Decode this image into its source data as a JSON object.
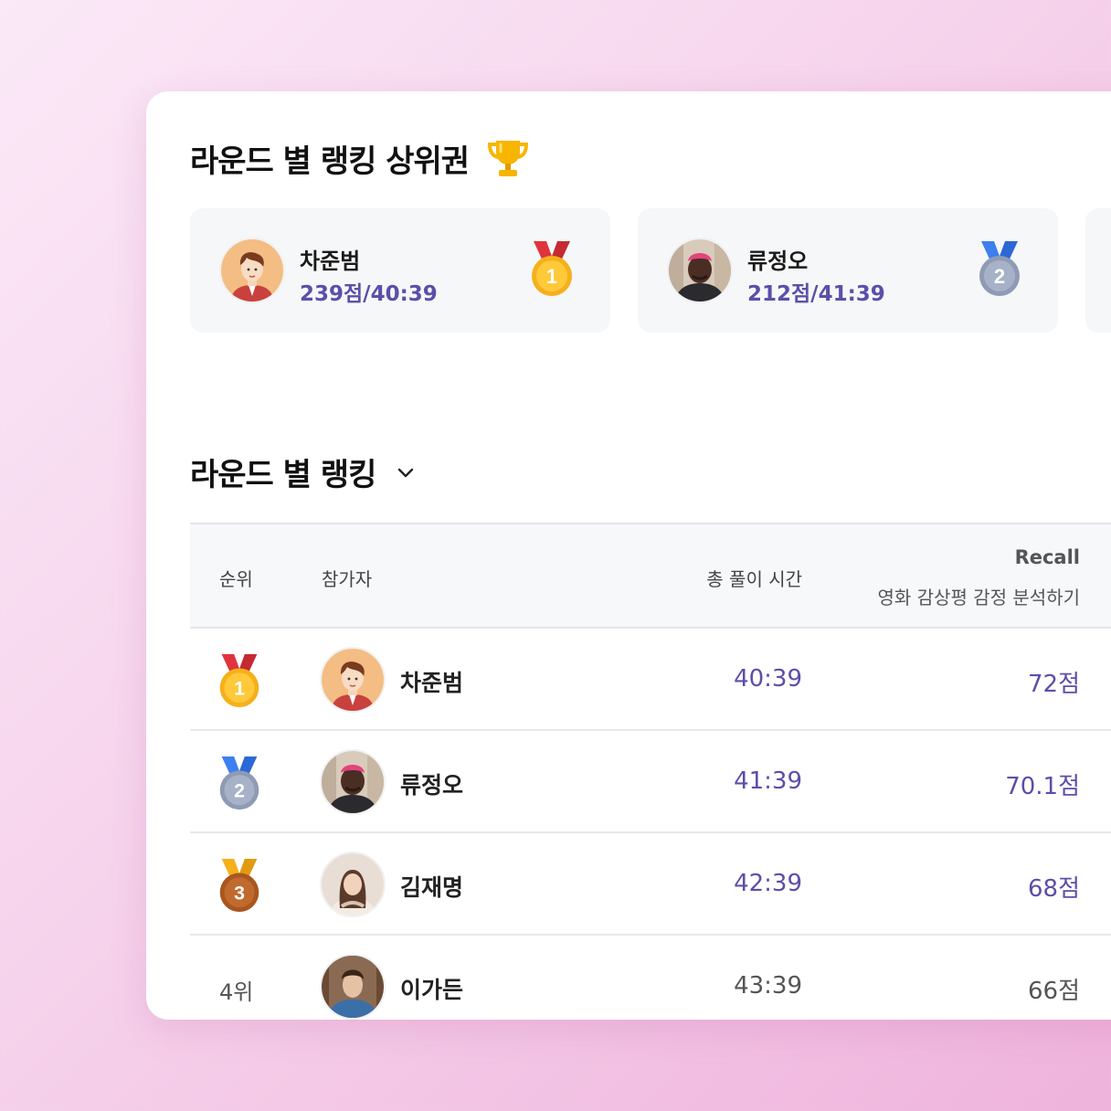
{
  "top_section": {
    "title": "라운드 별 랭킹 상위권",
    "trophy_icon": "trophy-icon",
    "cards": [
      {
        "name": "차준범",
        "score": "239점/40:39",
        "medal": "1",
        "medal_color": "gold"
      },
      {
        "name": "류정오",
        "score": "212점/41:39",
        "medal": "2",
        "medal_color": "silver"
      }
    ]
  },
  "ranking_section": {
    "title": "라운드 별 랭킹",
    "dropdown_icon": "chevron-down-icon"
  },
  "table": {
    "headers": {
      "rank": "순위",
      "player": "참가자",
      "total_time": "총 풀이 시간",
      "metric": "Recall",
      "task": "영화 감상평 감정 분석하기"
    },
    "rows": [
      {
        "rank": "1",
        "rank_text": "",
        "name": "차준범",
        "time": "40:39",
        "points": "72점"
      },
      {
        "rank": "2",
        "rank_text": "",
        "name": "류정오",
        "time": "41:39",
        "points": "70.1점"
      },
      {
        "rank": "3",
        "rank_text": "",
        "name": "김재명",
        "time": "42:39",
        "points": "68점"
      },
      {
        "rank": "4",
        "rank_text": "4위",
        "name": "이가든",
        "time": "43:39",
        "points": "66점"
      }
    ]
  },
  "colors": {
    "accent": "#5b4fa8",
    "gold": "#f5b01b",
    "silver": "#9aa6bf",
    "bronze": "#b8632a"
  }
}
